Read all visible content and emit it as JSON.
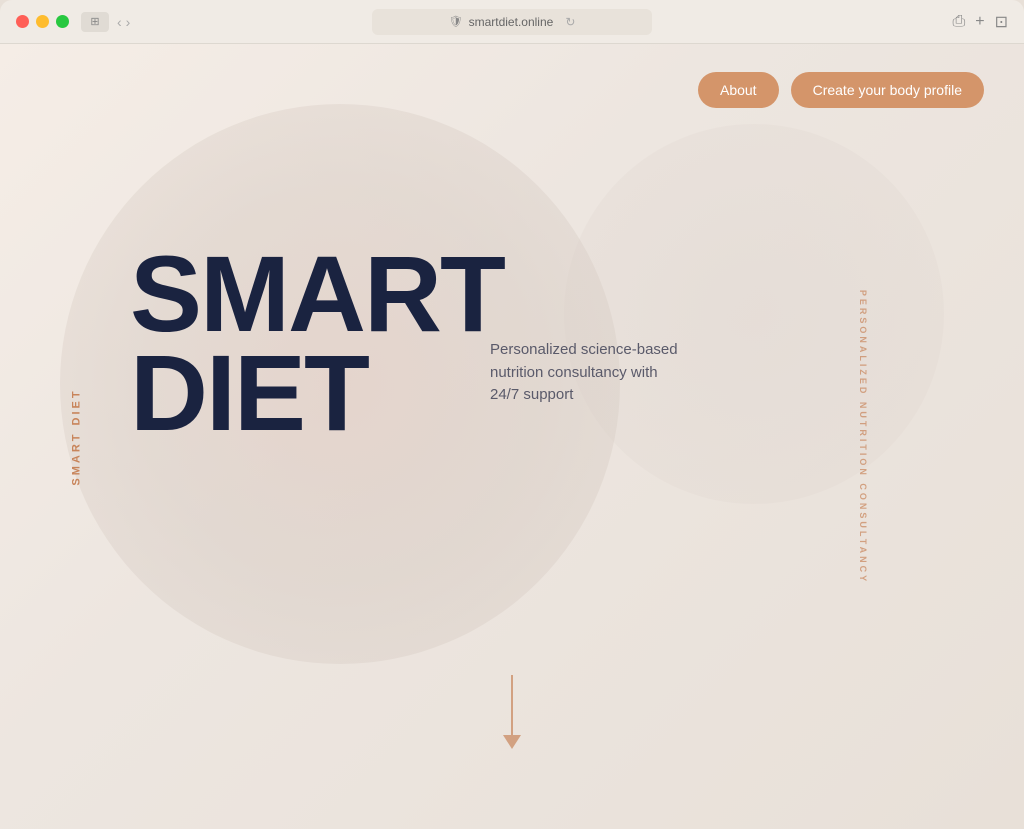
{
  "browser": {
    "url": "smartdiet.online",
    "traffic_lights": [
      "red",
      "yellow",
      "green"
    ]
  },
  "nav": {
    "about_label": "About",
    "profile_label": "Create your body profile"
  },
  "sidebar": {
    "left_label": "SMART DIET",
    "right_label": "PERSONALIZED NUTRITION CONSULTANCY"
  },
  "hero": {
    "title_line1": "SMART",
    "title_line2": "DIET",
    "subtitle": "Personalized science-based nutrition consultancy with 24/7 support"
  },
  "colors": {
    "accent": "#c8845a",
    "nav_button": "#d4956a",
    "title": "#1a2340",
    "subtitle": "#5a5a6a"
  }
}
